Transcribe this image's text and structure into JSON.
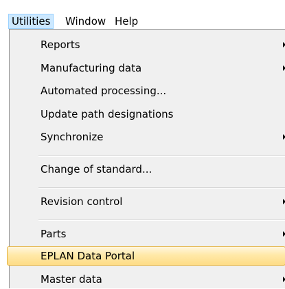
{
  "menubar": {
    "items": [
      {
        "label": "Utilities",
        "state": "open"
      },
      {
        "label": "Window"
      },
      {
        "label": "Help"
      }
    ]
  },
  "menu": {
    "items": [
      {
        "label": "Reports",
        "has_submenu": true
      },
      {
        "label": "Manufacturing data",
        "has_submenu": true
      },
      {
        "label": "Automated processing...",
        "has_submenu": false
      },
      {
        "label": "Update path designations",
        "has_submenu": false
      },
      {
        "label": "Synchronize",
        "has_submenu": true
      },
      {
        "label": "Change of standard...",
        "has_submenu": false
      },
      {
        "label": "Revision control",
        "has_submenu": true
      },
      {
        "label": "Parts",
        "has_submenu": true
      },
      {
        "label": "EPLAN Data Portal",
        "has_submenu": false,
        "state": "highlighted"
      },
      {
        "label": "Master data",
        "has_submenu": true
      }
    ]
  },
  "colors": {
    "open_menu_bg": "#cce8ff",
    "dropdown_bg": "#f0f0f0",
    "highlight_top": "#fff6dd",
    "highlight_bottom": "#fedc86",
    "highlight_border": "#e5b441"
  }
}
